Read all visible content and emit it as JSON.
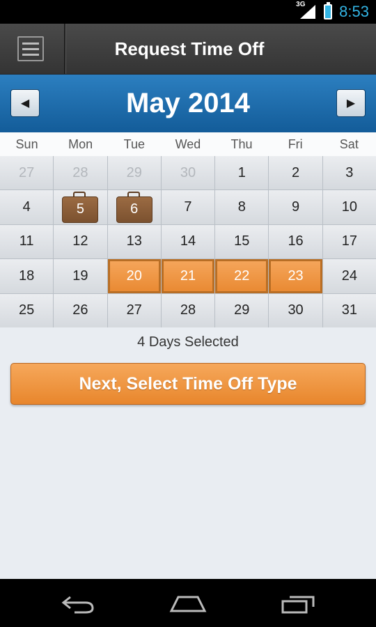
{
  "status_bar": {
    "network": "3G",
    "time": "8:53",
    "icons": [
      "signal-icon",
      "battery-charging-icon"
    ]
  },
  "header": {
    "title": "Request Time Off",
    "menu_icon": "menu-icon"
  },
  "calendar": {
    "month_title": "May 2014",
    "prev_icon": "chevron-left-icon",
    "next_icon": "chevron-right-icon",
    "weekdays": [
      "Sun",
      "Mon",
      "Tue",
      "Wed",
      "Thu",
      "Fri",
      "Sat"
    ],
    "days": [
      {
        "label": "27",
        "state": "muted"
      },
      {
        "label": "28",
        "state": "muted"
      },
      {
        "label": "29",
        "state": "muted"
      },
      {
        "label": "30",
        "state": "muted"
      },
      {
        "label": "1",
        "state": "normal"
      },
      {
        "label": "2",
        "state": "normal"
      },
      {
        "label": "3",
        "state": "normal"
      },
      {
        "label": "4",
        "state": "normal"
      },
      {
        "label": "5",
        "state": "booked"
      },
      {
        "label": "6",
        "state": "booked"
      },
      {
        "label": "7",
        "state": "normal"
      },
      {
        "label": "8",
        "state": "normal"
      },
      {
        "label": "9",
        "state": "normal"
      },
      {
        "label": "10",
        "state": "normal"
      },
      {
        "label": "11",
        "state": "normal"
      },
      {
        "label": "12",
        "state": "normal"
      },
      {
        "label": "13",
        "state": "normal"
      },
      {
        "label": "14",
        "state": "normal"
      },
      {
        "label": "15",
        "state": "normal"
      },
      {
        "label": "16",
        "state": "normal"
      },
      {
        "label": "17",
        "state": "normal"
      },
      {
        "label": "18",
        "state": "normal"
      },
      {
        "label": "19",
        "state": "normal"
      },
      {
        "label": "20",
        "state": "selected"
      },
      {
        "label": "21",
        "state": "selected"
      },
      {
        "label": "22",
        "state": "selected"
      },
      {
        "label": "23",
        "state": "selected"
      },
      {
        "label": "24",
        "state": "normal"
      },
      {
        "label": "25",
        "state": "normal"
      },
      {
        "label": "26",
        "state": "normal"
      },
      {
        "label": "27",
        "state": "normal"
      },
      {
        "label": "28",
        "state": "normal"
      },
      {
        "label": "29",
        "state": "normal"
      },
      {
        "label": "30",
        "state": "normal"
      },
      {
        "label": "31",
        "state": "normal"
      }
    ]
  },
  "summary": "4 Days Selected",
  "cta": {
    "label": "Next, Select Time Off Type"
  },
  "nav_bar": {
    "icons": [
      "back-icon",
      "home-icon",
      "recent-apps-icon"
    ]
  },
  "colors": {
    "accent_orange": "#e98a33",
    "header_blue": "#1f6fb0",
    "status_blue": "#33b5e5",
    "booked_brown": "#8b5e3c"
  }
}
